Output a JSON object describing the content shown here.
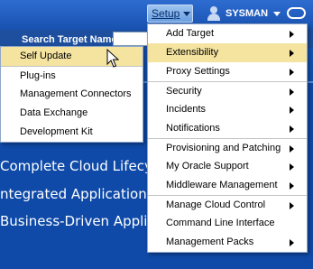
{
  "header": {
    "setup_label": "Setup",
    "user_label": "SYSMAN"
  },
  "search": {
    "label": "Search Target Name"
  },
  "banner": {
    "line1": "Complete Cloud Lifecyc",
    "line2": "ntegrated Application-",
    "line3": "Business-Driven Applic"
  },
  "setup_menu": {
    "items": [
      {
        "label": "Add Target"
      },
      {
        "label": "Extensibility"
      },
      {
        "label": "Proxy Settings"
      },
      {
        "label": "Security"
      },
      {
        "label": "Incidents"
      },
      {
        "label": "Notifications"
      },
      {
        "label": "Provisioning and Patching"
      },
      {
        "label": "My Oracle Support"
      },
      {
        "label": "Middleware Management"
      },
      {
        "label": "Manage Cloud Control"
      },
      {
        "label": "Command Line Interface"
      },
      {
        "label": "Management Packs"
      }
    ]
  },
  "extensibility_menu": {
    "items": [
      {
        "label": "Self Update"
      },
      {
        "label": "Plug-ins"
      },
      {
        "label": "Management Connectors"
      },
      {
        "label": "Data Exchange"
      },
      {
        "label": "Development Kit"
      }
    ]
  },
  "colors": {
    "highlight": "#f4e4a0",
    "header_blue": "#1852b0",
    "menu_border": "#8fa7c9"
  }
}
